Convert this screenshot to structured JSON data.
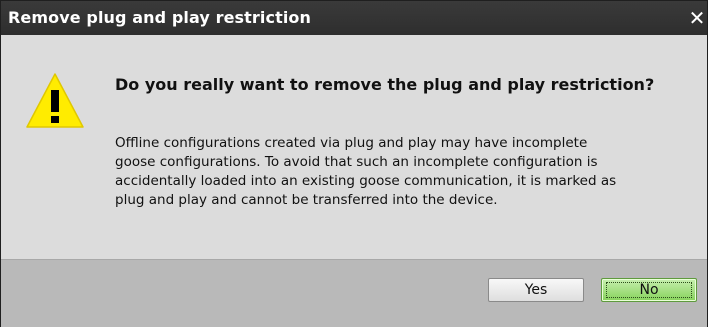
{
  "dialog": {
    "title": "Remove plug and play restriction",
    "close_glyph": "✕",
    "icon": "warning-icon",
    "question": "Do you really want to remove the plug and play restriction?",
    "message_lines": [
      "Offline configurations created via plug and play may have incomplete",
      "goose configurations. To avoid that such an incomplete configuration is",
      "accidentally loaded into an existing goose communication, it is marked as",
      "plug and play and cannot be transferred into the device."
    ]
  },
  "buttons": {
    "yes_label": "Yes",
    "no_label": "No"
  },
  "colors": {
    "titlebar": "#2e2e2e",
    "content_bg": "#dcdcdc",
    "footer_bg": "#b9b9b9",
    "warning_yellow": "#ffec00",
    "no_button_green": "#86d25a"
  }
}
